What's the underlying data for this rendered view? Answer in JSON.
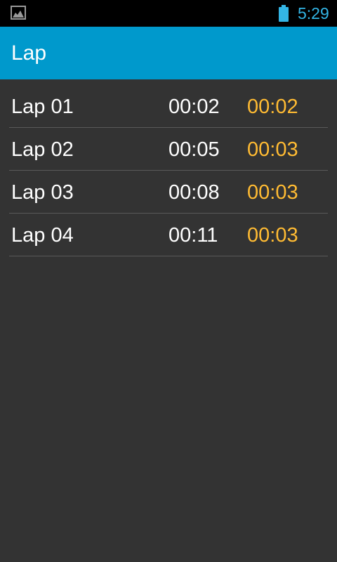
{
  "status_bar": {
    "notification_icon": "image-icon",
    "battery_icon": "battery-full-icon",
    "time": "5:29"
  },
  "action_bar": {
    "title": "Lap"
  },
  "laps": [
    {
      "name": "Lap 01",
      "total": "00:02",
      "split": "00:02"
    },
    {
      "name": "Lap 02",
      "total": "00:05",
      "split": "00:03"
    },
    {
      "name": "Lap 03",
      "total": "00:08",
      "split": "00:03"
    },
    {
      "name": "Lap 04",
      "total": "00:11",
      "split": "00:03"
    }
  ],
  "colors": {
    "action_bar": "#0099cc",
    "status_accent": "#33b5e5",
    "split_time": "#ffbb33",
    "background": "#333333"
  }
}
